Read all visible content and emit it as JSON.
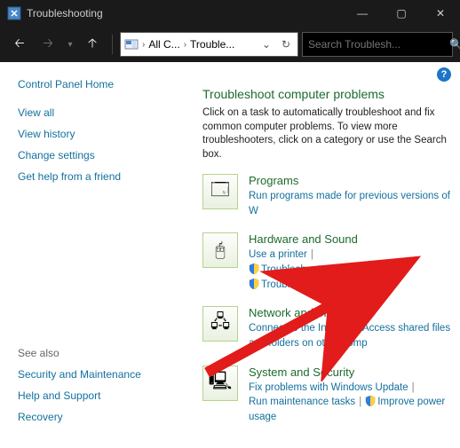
{
  "window": {
    "title": "Troubleshooting",
    "min": "—",
    "max": "▢",
    "close": "✕"
  },
  "nav": {
    "back": "🡠",
    "forward": "🡢",
    "up": "🡡",
    "history": "▾"
  },
  "address": {
    "seg1": "All C...",
    "seg2": "Trouble..."
  },
  "search": {
    "placeholder": "Search Troublesh...",
    "icon": "🔍"
  },
  "sidebar": {
    "home": "Control Panel Home",
    "links": [
      "View all",
      "View history",
      "Change settings",
      "Get help from a friend"
    ],
    "seealso_header": "See also",
    "seealso": [
      "Security and Maintenance",
      "Help and Support",
      "Recovery"
    ]
  },
  "main": {
    "heading": "Troubleshoot computer problems",
    "intro": "Click on a task to automatically troubleshoot and fix common computer problems. To view more troubleshooters, click on a category or use the Search box.",
    "help": "?",
    "categories": [
      {
        "title": "Programs",
        "subs": [
          {
            "text": "Run programs made for previous versions of W",
            "shield": false
          }
        ]
      },
      {
        "title": "Hardware and Sound",
        "subs": [
          {
            "text": "Use a printer",
            "shield": false
          },
          {
            "text": "Troubleshoot audio recording",
            "shield": true
          },
          {
            "text": "Troubleshoot audio playback",
            "shield": true
          }
        ]
      },
      {
        "title": "Network and Internet",
        "subs": [
          {
            "text": "Connect to the Internet",
            "shield": false
          },
          {
            "text": "Access shared files and folders on other comp",
            "shield": false
          }
        ]
      },
      {
        "title": "System and Security",
        "subs": [
          {
            "text": "Fix problems with Windows Update",
            "shield": false
          },
          {
            "text": "Run maintenance tasks",
            "shield": false
          },
          {
            "text": "Improve power usage",
            "shield": true
          }
        ]
      }
    ]
  },
  "icon_glyphs": {
    "programs": "🗔",
    "hardware": "🖰",
    "network": "🖧",
    "system": "🖳"
  }
}
